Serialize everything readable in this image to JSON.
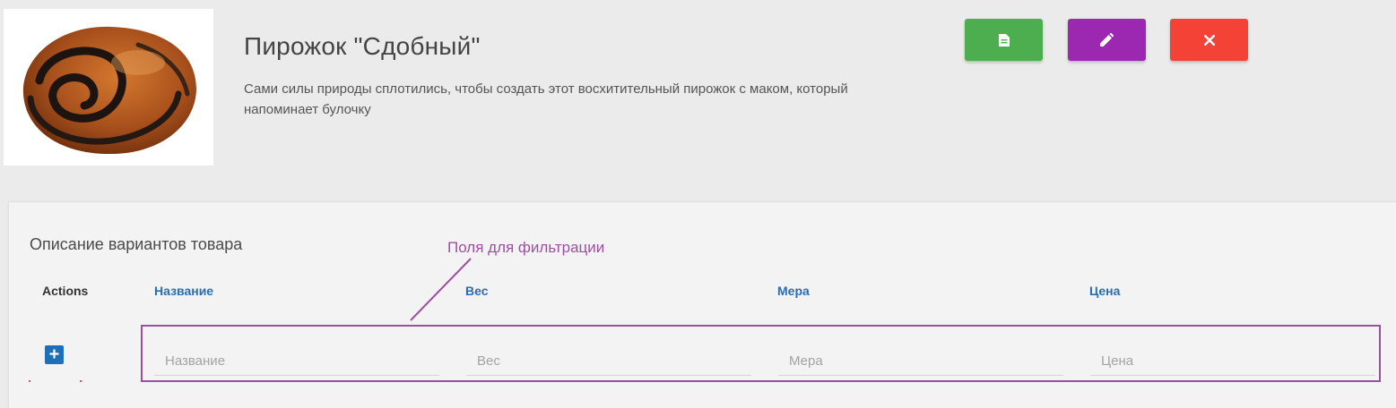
{
  "product": {
    "title": "Пирожок \"Сдобный\"",
    "description": "Сами силы природы сплотились, чтобы создать этот восхитительный пирожок с маком, который напоминает булочку"
  },
  "toolbar": {
    "buttons": [
      {
        "icon": "document-icon",
        "color": "#4cae4f"
      },
      {
        "icon": "pencil-icon",
        "color": "#9c27b0"
      },
      {
        "icon": "close-icon",
        "color": "#f44336"
      }
    ]
  },
  "variants": {
    "title": "Описание вариантов товара",
    "columns": {
      "actions": "Actions",
      "name": "Название",
      "weight": "Вес",
      "measure": "Мера",
      "price": "Цена"
    },
    "filters": {
      "name_placeholder": "Название",
      "weight_placeholder": "Вес",
      "measure_placeholder": "Мера",
      "price_placeholder": "Цена",
      "add_icon": "plus-icon",
      "add_color": "#1e6fb5"
    }
  },
  "annotation": {
    "label": "Поля для фильтрации",
    "color": "#9d4f9f"
  }
}
